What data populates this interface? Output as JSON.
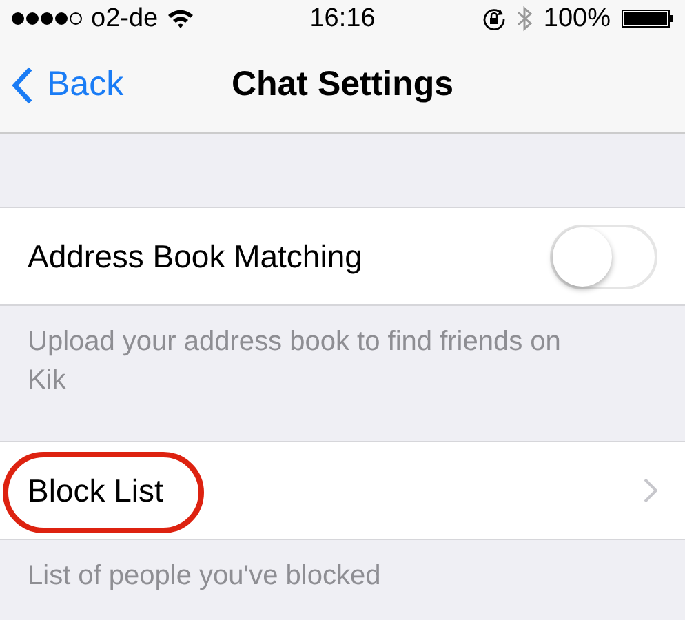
{
  "status_bar": {
    "carrier": "o2-de",
    "time": "16:16",
    "battery": "100%"
  },
  "nav_bar": {
    "back": "Back",
    "title": "Chat Settings"
  },
  "sections": [
    {
      "kind": "toggle",
      "label": "Address Book Matching",
      "on": false,
      "footer": "Upload your address book to find friends on Kik",
      "circled": false
    },
    {
      "kind": "link",
      "label": "Block List",
      "circled": true,
      "footer": "List of people you've blocked"
    }
  ]
}
